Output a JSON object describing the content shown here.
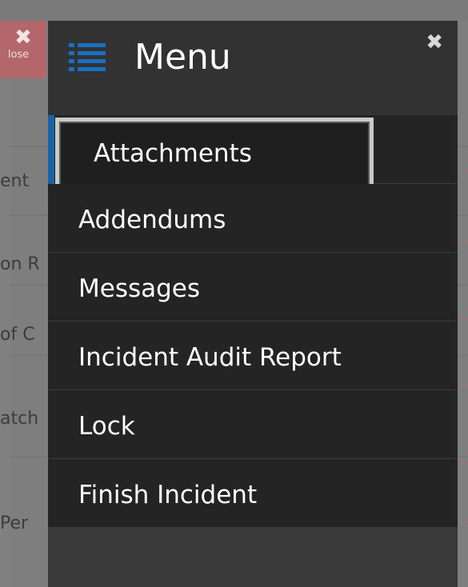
{
  "background": {
    "close_button": {
      "icon": "close-icon",
      "label": "lose"
    },
    "row_labels": [
      "ent",
      "on R",
      "of C",
      "atch",
      "Per"
    ]
  },
  "menu": {
    "title": "Menu",
    "title_icon": "hamburger-list-icon",
    "close_icon": "close-icon",
    "close_glyph": "✖",
    "items": [
      {
        "label": "Attachments",
        "focused": true
      },
      {
        "label": "Addendums"
      },
      {
        "label": "Messages"
      },
      {
        "label": "Incident Audit Report"
      },
      {
        "label": "Lock"
      },
      {
        "label": "Finish Incident"
      }
    ]
  },
  "colors": {
    "accent_blue": "#1a63a8",
    "panel_bg": "#242424",
    "header_bg": "#323232",
    "focus_border": "#c9c9c9"
  }
}
